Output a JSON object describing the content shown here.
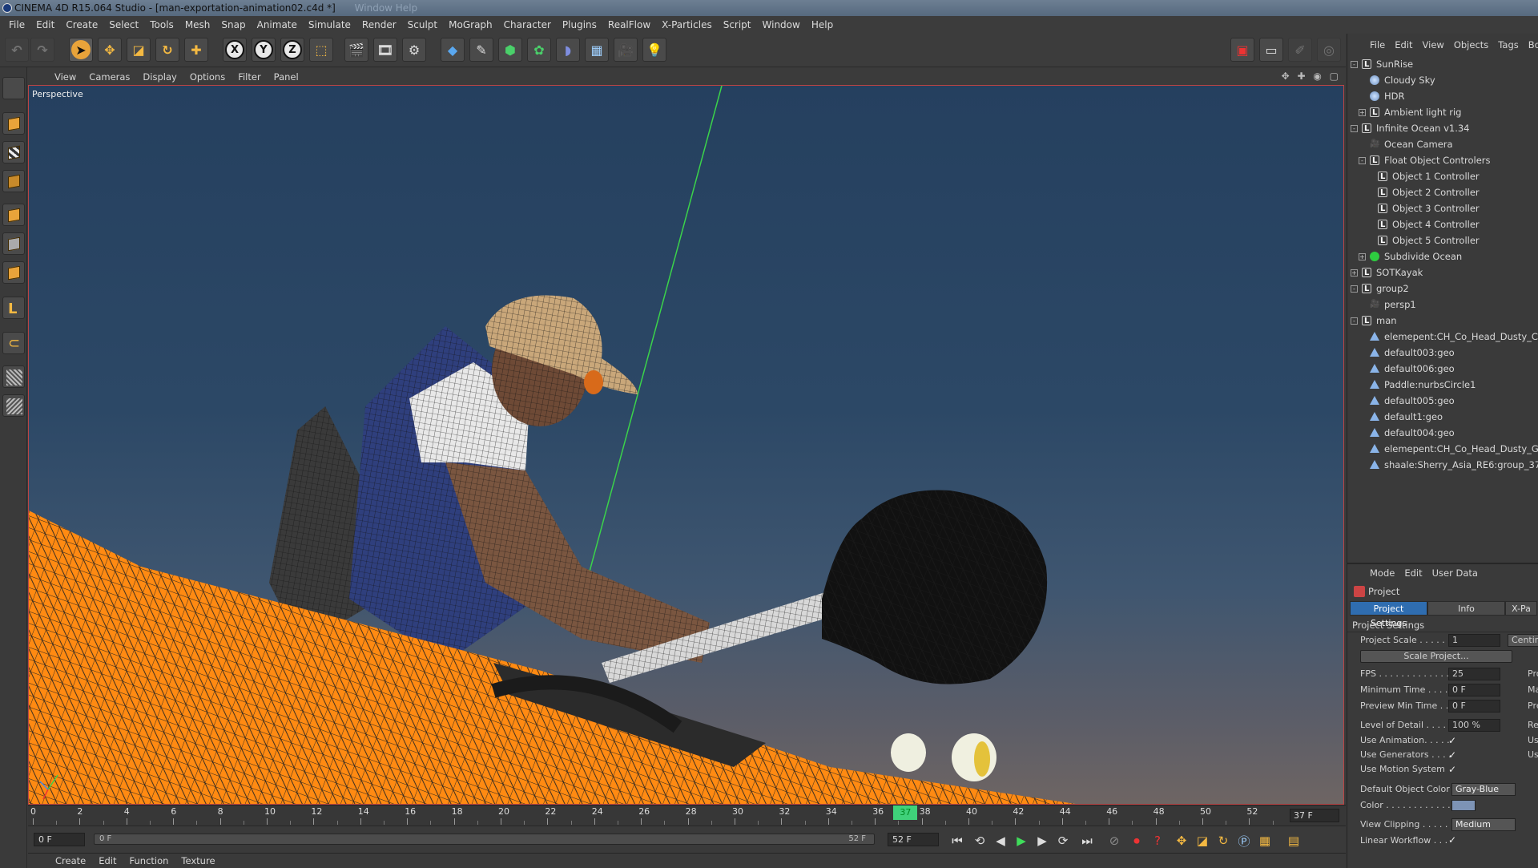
{
  "window": {
    "title": "CINEMA 4D R15.064 Studio - [man-exportation-animation02.c4d *]",
    "faded_menu": "Window   Help"
  },
  "menu": [
    "File",
    "Edit",
    "Create",
    "Select",
    "Tools",
    "Mesh",
    "Snap",
    "Animate",
    "Simulate",
    "Render",
    "Sculpt",
    "MoGraph",
    "Character",
    "Plugins",
    "RealFlow",
    "X-Particles",
    "Script",
    "Window",
    "Help"
  ],
  "toolbar": {
    "axis_x": "X",
    "axis_y": "Y",
    "axis_z": "Z"
  },
  "viewport": {
    "menu": [
      "View",
      "Cameras",
      "Display",
      "Options",
      "Filter",
      "Panel"
    ],
    "label": "Perspective",
    "icons": "✥ ✚ ◉ ▢"
  },
  "timeline": {
    "ticks": [
      "0",
      "2",
      "4",
      "6",
      "8",
      "10",
      "12",
      "14",
      "16",
      "18",
      "20",
      "22",
      "24",
      "26",
      "28",
      "30",
      "32",
      "34",
      "36",
      "38",
      "40",
      "42",
      "44",
      "46",
      "48",
      "50",
      "52"
    ],
    "current": "37",
    "end_field": "37 F"
  },
  "transport": {
    "start_field": "0 F",
    "slider_left": "0 F",
    "slider_right": "52 F",
    "end_field": "52 F"
  },
  "material_menu": [
    "Create",
    "Edit",
    "Function",
    "Texture"
  ],
  "object_manager": {
    "menu": [
      "File",
      "Edit",
      "View",
      "Objects",
      "Tags",
      "Boo"
    ],
    "rows": [
      {
        "name": "SunRise",
        "level": 0,
        "icon": "null",
        "expand": "-"
      },
      {
        "name": "Cloudy Sky",
        "level": 1,
        "icon": "sky",
        "expand": ""
      },
      {
        "name": "HDR",
        "level": 1,
        "icon": "sky",
        "expand": ""
      },
      {
        "name": "Ambient light rig",
        "level": 1,
        "icon": "null",
        "expand": "+"
      },
      {
        "name": "Infinite Ocean v1.34",
        "level": 0,
        "icon": "null",
        "expand": "-"
      },
      {
        "name": "Ocean Camera",
        "level": 1,
        "icon": "cam",
        "expand": ""
      },
      {
        "name": "Float Object Controlers",
        "level": 1,
        "icon": "null",
        "expand": "-"
      },
      {
        "name": "Object 1 Controller",
        "level": 2,
        "icon": "null",
        "expand": ""
      },
      {
        "name": "Object 2 Controller",
        "level": 2,
        "icon": "null",
        "expand": ""
      },
      {
        "name": "Object 3 Controller",
        "level": 2,
        "icon": "null",
        "expand": ""
      },
      {
        "name": "Object 4 Controller",
        "level": 2,
        "icon": "null",
        "expand": ""
      },
      {
        "name": "Object 5 Controller",
        "level": 2,
        "icon": "null",
        "expand": ""
      },
      {
        "name": "Subdivide Ocean",
        "level": 1,
        "icon": "gen",
        "expand": "+"
      },
      {
        "name": "SOTKayak",
        "level": 0,
        "icon": "null",
        "expand": "+"
      },
      {
        "name": "group2",
        "level": 0,
        "icon": "null",
        "expand": "-"
      },
      {
        "name": "persp1",
        "level": 1,
        "icon": "cam",
        "expand": ""
      },
      {
        "name": "man",
        "level": 0,
        "icon": "null",
        "expand": "-"
      },
      {
        "name": "elemepent:CH_Co_Head_Dusty_Cap",
        "level": 1,
        "icon": "poly",
        "expand": ""
      },
      {
        "name": "default003:geo",
        "level": 1,
        "icon": "poly",
        "expand": ""
      },
      {
        "name": "default006:geo",
        "level": 1,
        "icon": "poly",
        "expand": ""
      },
      {
        "name": "Paddle:nurbsCircle1",
        "level": 1,
        "icon": "poly",
        "expand": ""
      },
      {
        "name": "default005:geo",
        "level": 1,
        "icon": "poly",
        "expand": ""
      },
      {
        "name": "default1:geo",
        "level": 1,
        "icon": "poly",
        "expand": ""
      },
      {
        "name": "default004:geo",
        "level": 1,
        "icon": "poly",
        "expand": ""
      },
      {
        "name": "elemepent:CH_Co_Head_Dusty_Glass",
        "level": 1,
        "icon": "poly",
        "expand": ""
      },
      {
        "name": "shaale:Sherry_Asia_RE6:group_37",
        "level": 1,
        "icon": "poly",
        "expand": ""
      }
    ]
  },
  "attribute_manager": {
    "menu": [
      "Mode",
      "Edit",
      "User Data"
    ],
    "object": "Project",
    "tabs": [
      "Project Settings",
      "Info",
      "X-Pa"
    ],
    "section": "Project Settings",
    "project_scale": {
      "label": "Project Scale . . . . . .",
      "value": "1",
      "unit": "Centim"
    },
    "scale_button": "Scale Project...",
    "fps": {
      "label": "FPS . . . . . . . . . . . . . .",
      "value": "25",
      "extra": "Pro"
    },
    "min_time": {
      "label": "Minimum Time . . . . .",
      "value": "0 F",
      "extra": "Ma"
    },
    "preview_min": {
      "label": "Preview Min Time . .",
      "value": "0 F",
      "extra": "Pre"
    },
    "lod": {
      "label": "Level of Detail . . . . .",
      "value": "100 %",
      "extra": "Re"
    },
    "use_animation": {
      "label": "Use Animation. . . . .",
      "value": "✓",
      "extra": "Us"
    },
    "use_generators": {
      "label": "Use Generators . . . .",
      "value": "✓",
      "extra": "Us"
    },
    "use_motion": {
      "label": "Use Motion System",
      "value": "✓"
    },
    "default_color": {
      "label": "Default Object Color",
      "value": "Gray-Blue"
    },
    "color": {
      "label": "Color . . . . . . . . . . . ."
    },
    "view_clipping": {
      "label": "View Clipping . . . . .",
      "value": "Medium"
    },
    "linear_workflow": {
      "label": "Linear Workflow . . .",
      "value": "✓"
    },
    "colors": {
      "swatch": "#7d93b5",
      "active_tab": "#2f6db0"
    }
  }
}
